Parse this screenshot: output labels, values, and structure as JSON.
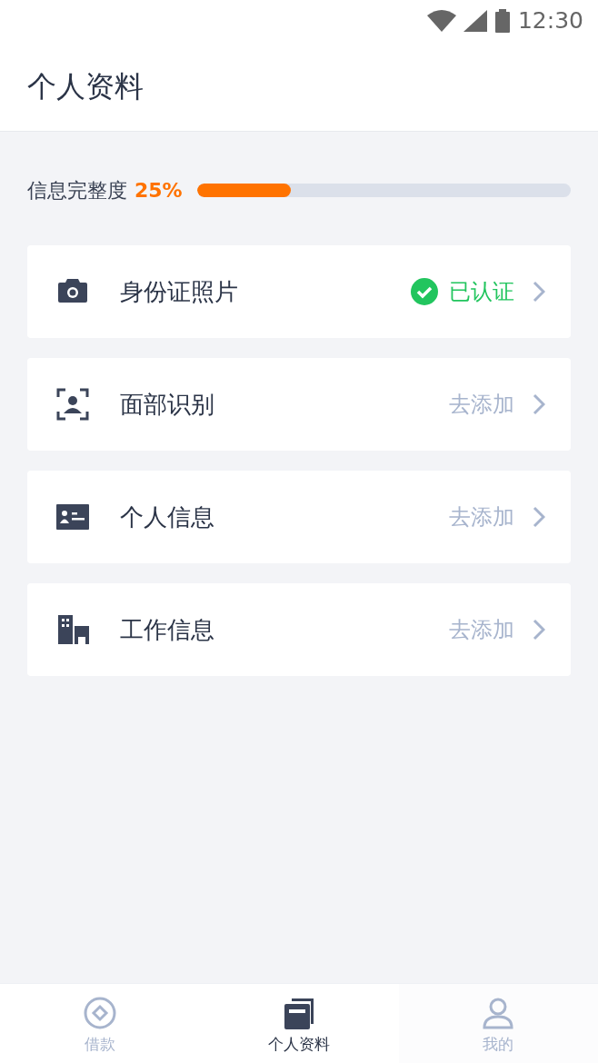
{
  "status_bar": {
    "time": "12:30"
  },
  "header": {
    "title": "个人资料"
  },
  "completeness": {
    "label": "信息完整度",
    "percent": "25%",
    "level": 0.25
  },
  "items": [
    {
      "label": "身份证照片",
      "status": "已认证",
      "verified": true
    },
    {
      "label": "面部识别",
      "status": "去添加",
      "verified": false
    },
    {
      "label": "个人信息",
      "status": "去添加",
      "verified": false
    },
    {
      "label": "工作信息",
      "status": "去添加",
      "verified": false
    }
  ],
  "tabs": [
    {
      "label": "借款",
      "selected": false
    },
    {
      "label": "个人资料",
      "selected": true
    },
    {
      "label": "我的",
      "selected": false
    }
  ]
}
